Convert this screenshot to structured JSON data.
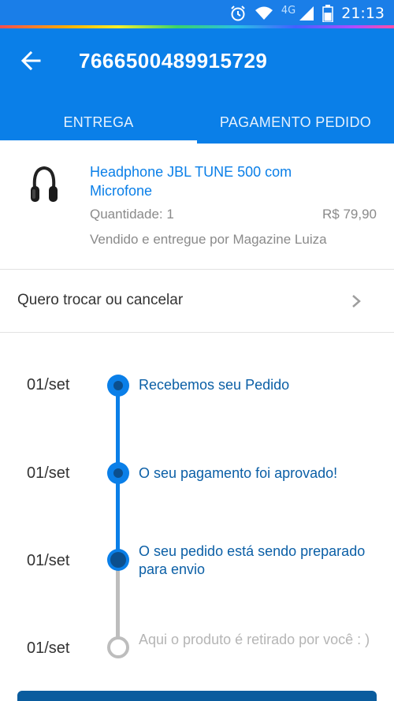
{
  "status_bar": {
    "network": "4G",
    "time": "21:13",
    "icons": [
      "alarm-icon",
      "wifi-icon",
      "signal-icon",
      "battery-icon"
    ]
  },
  "app_bar": {
    "title": "7666500489915729",
    "back_icon": "arrow-back-icon",
    "tabs": [
      {
        "label": "ENTREGA",
        "active": true
      },
      {
        "label": "PAGAMENTO PEDIDO",
        "active": false
      }
    ]
  },
  "product": {
    "image": "headphone-image",
    "name": "Headphone JBL TUNE 500 com Microfone",
    "quantity": "Quantidade: 1",
    "price": "R$ 79,90",
    "seller": "Vendido e entregue por Magazine Luiza"
  },
  "exchange": {
    "label": "Quero trocar ou cancelar",
    "icon": "chevron-right-icon"
  },
  "timeline": {
    "items": [
      {
        "date": "01/set",
        "text": "Recebemos seu Pedido",
        "status": "done"
      },
      {
        "date": "01/set",
        "text": "O seu pagamento foi aprovado!",
        "status": "done"
      },
      {
        "date": "01/set",
        "text": "O seu pedido está sendo preparado para envio",
        "status": "current"
      },
      {
        "date": "01/set",
        "text": "Aqui o produto é retirado por você : )",
        "status": "pending"
      }
    ]
  },
  "colors": {
    "primary": "#0a7fe8",
    "dark_blue": "#0b4f8e",
    "text_blue": "#0b5fa6",
    "grey_text": "#8a8a8a",
    "pending_grey": "#bdbdbd"
  }
}
